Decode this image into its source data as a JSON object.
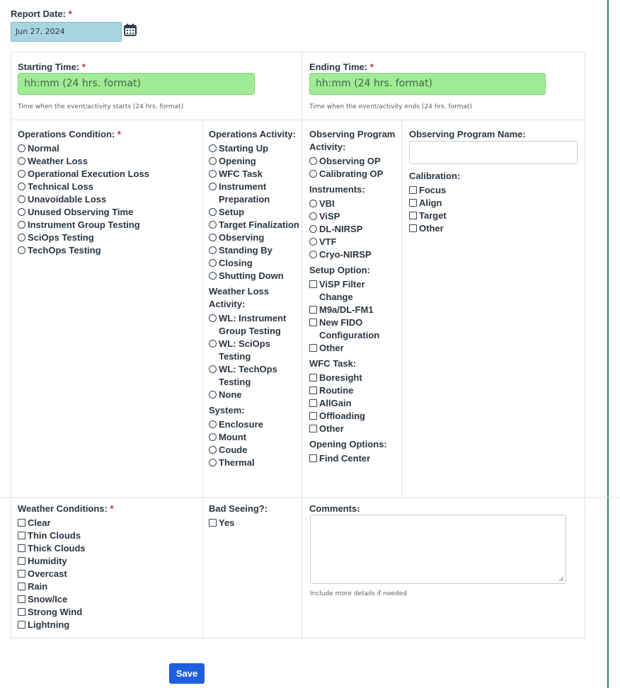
{
  "report_date": {
    "label": "Report Date:",
    "required": "*",
    "value": "Jun 27, 2024"
  },
  "starting_time": {
    "label": "Starting Time:",
    "required": "*",
    "placeholder": "hh:mm (24 hrs. format)",
    "help": "Time when the event/activity starts (24 hrs. format)"
  },
  "ending_time": {
    "label": "Ending Time:",
    "required": "*",
    "placeholder": "hh:mm (24 hrs. format)",
    "help": "Time when the event/activity ends (24 hrs. format)"
  },
  "operations_condition": {
    "label": "Operations Condition:",
    "required": "*",
    "options": [
      "Normal",
      "Weather Loss",
      "Operational Execution Loss",
      "Technical Loss",
      "Unavoidable Loss",
      "Unused Observing Time",
      "Instrument Group Testing",
      "SciOps Testing",
      "TechOps Testing"
    ]
  },
  "operations_activity": {
    "label": "Operations Activity:",
    "options": [
      "Starting Up",
      "Opening",
      "WFC Task",
      "Instrument Preparation",
      "Setup",
      "Target Finalization",
      "Observing",
      "Standing By",
      "Closing",
      "Shutting Down"
    ]
  },
  "weather_loss_activity": {
    "label": "Weather Loss Activity:",
    "options": [
      "WL: Instrument Group Testing",
      "WL: SciOps Testing",
      "WL: TechOps Testing",
      "None"
    ]
  },
  "system": {
    "label": "System:",
    "options": [
      "Enclosure",
      "Mount",
      "Coude",
      "Thermal"
    ]
  },
  "observing_program_activity": {
    "label": "Observing Program Activity:",
    "options": [
      "Observing OP",
      "Calibrating OP"
    ]
  },
  "instruments": {
    "label": "Instruments:",
    "options": [
      "VBI",
      "ViSP",
      "DL-NIRSP",
      "VTF",
      "Cryo-NIRSP"
    ]
  },
  "setup_option": {
    "label": "Setup Option:",
    "options": [
      "ViSP Filter Change",
      "M9a/DL-FM1",
      "New FIDO Configuration",
      "Other"
    ]
  },
  "wfc_task": {
    "label": "WFC Task:",
    "options": [
      "Boresight",
      "Routine",
      "AllGain",
      "Offloading",
      "Other"
    ]
  },
  "opening_options": {
    "label": "Opening Options:",
    "options": [
      "Find Center"
    ]
  },
  "observing_program_name": {
    "label": "Observing Program Name:",
    "value": ""
  },
  "calibration": {
    "label": "Calibration:",
    "options": [
      "Focus",
      "Align",
      "Target",
      "Other"
    ]
  },
  "weather_conditions": {
    "label": "Weather Conditions:",
    "required": "*",
    "options": [
      "Clear",
      "Thin Clouds",
      "Thick Clouds",
      "Humidity",
      "Overcast",
      "Rain",
      "Snow/Ice",
      "Strong Wind",
      "Lightning"
    ]
  },
  "bad_seeing": {
    "label": "Bad Seeing?:",
    "options": [
      "Yes"
    ]
  },
  "comments": {
    "label": "Comments:",
    "help": "Include more details if needed",
    "value": ""
  },
  "save_label": "Save",
  "icons": {
    "calendar": "calendar-icon"
  },
  "colors": {
    "time_input_bg": "#a0eb95",
    "date_input_bg": "#a9d5e2",
    "save_bg": "#1f5fde",
    "required": "#d62828"
  }
}
